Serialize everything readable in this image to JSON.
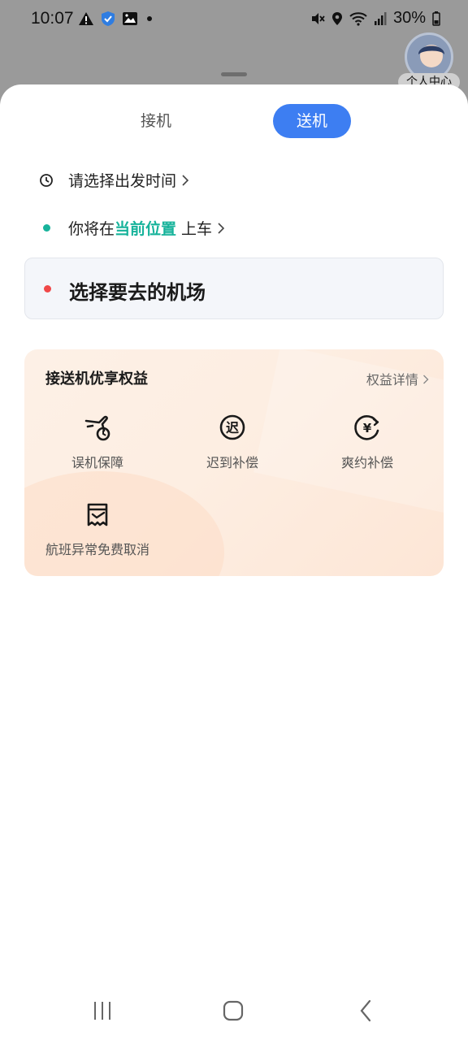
{
  "status_bar": {
    "time": "10:07",
    "battery": "30%",
    "left_icons": [
      "warning-icon",
      "shield-icon",
      "image-icon",
      "dot-icon"
    ],
    "right_icons": [
      "mute-icon",
      "location-icon",
      "wifi-icon",
      "signal-icon",
      "battery-icon"
    ]
  },
  "profile": {
    "label": "个人中心"
  },
  "tabs": [
    {
      "label": "接机",
      "active": false
    },
    {
      "label": "送机",
      "active": true
    }
  ],
  "departure": {
    "label": "请选择出发时间"
  },
  "pickup_location": {
    "prefix": "你将在",
    "highlight": "当前位置",
    "suffix": "上车"
  },
  "destination": {
    "label": "选择要去的机场"
  },
  "benefits": {
    "title": "接送机优享权益",
    "details_link": "权益详情",
    "items": [
      {
        "label": "误机保障",
        "icon": "missed-flight-icon"
      },
      {
        "label": "迟到补偿",
        "icon": "late-compensation-icon"
      },
      {
        "label": "爽约补偿",
        "icon": "no-show-compensation-icon"
      },
      {
        "label": "航班异常免费取消",
        "icon": "flight-cancel-icon"
      }
    ]
  },
  "colors": {
    "accent_blue": "#3d7ef2",
    "accent_green": "#17b39b",
    "accent_red": "#f04848"
  }
}
